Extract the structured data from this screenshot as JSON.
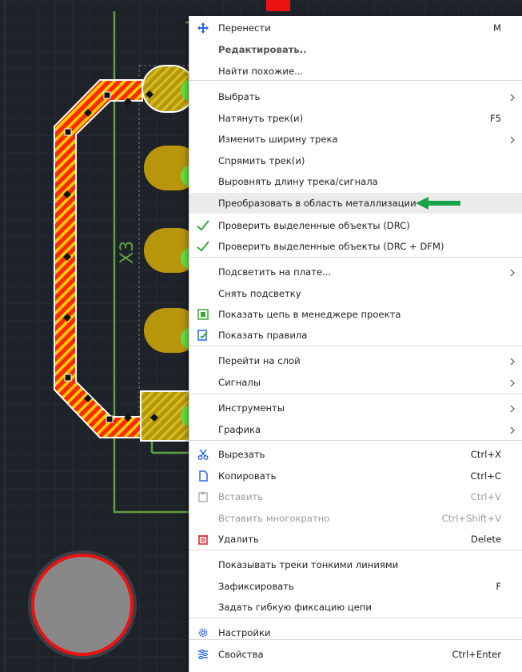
{
  "pcb": {
    "designator": "X3",
    "colors": {
      "bg": "#1e2229",
      "grid": "#2e333b",
      "silk": "#5fa142",
      "pad": "#b8960c",
      "pad_dot": "#66dd44",
      "track": "#ff2200",
      "stripe": "#ffcc00",
      "button_fill": "#888888",
      "button_ring": "#ee1111"
    }
  },
  "menu": {
    "items": [
      {
        "label": "Перенести",
        "shortcut": "M",
        "icon": "move-icon"
      },
      {
        "label": "Редактировать..",
        "style": "bold"
      },
      {
        "label": "Найти похожие..."
      },
      {
        "label": "Выбрать",
        "submenu": true
      },
      {
        "label": "Натянуть трек(и)",
        "shortcut": "F5"
      },
      {
        "label": "Изменить ширину трека",
        "submenu": true
      },
      {
        "label": "Спрямить трек(и)"
      },
      {
        "label": "Выровнять длину трека/сигнала"
      },
      {
        "label": "Преобразовать в область металлизации",
        "highlighted": true,
        "annotation": "green-arrow"
      },
      {
        "label": "Проверить выделенные объекты (DRC)",
        "icon": "checkmark-icon"
      },
      {
        "label": "Проверить выделенные объекты (DRC + DFM)",
        "icon": "checkmark-icon"
      },
      {
        "label": "Подсветить на плате...",
        "submenu": true
      },
      {
        "label": "Снять подсветку"
      },
      {
        "label": "Показать цепь в менеджере проекта",
        "icon": "project-manager-icon"
      },
      {
        "label": "Показать правила",
        "icon": "rules-icon"
      },
      {
        "label": "Перейти на слой",
        "submenu": true
      },
      {
        "label": "Сигналы",
        "submenu": true
      },
      {
        "label": "Инструменты",
        "submenu": true
      },
      {
        "label": "Графика",
        "submenu": true
      },
      {
        "label": "Вырезать",
        "shortcut": "Ctrl+X",
        "icon": "scissors-icon"
      },
      {
        "label": "Копировать",
        "shortcut": "Ctrl+C",
        "icon": "copy-icon"
      },
      {
        "label": "Вставить",
        "shortcut": "Ctrl+V",
        "icon": "paste-icon",
        "disabled": true
      },
      {
        "label": "Вставить многократно",
        "shortcut": "Ctrl+Shift+V",
        "disabled": true
      },
      {
        "label": "Удалить",
        "shortcut": "Delete",
        "icon": "trash-icon"
      },
      {
        "label": "Показывать треки тонкими линиями"
      },
      {
        "label": "Зафиксировать",
        "shortcut": "F"
      },
      {
        "label": "Задать гибкую фиксацию цепи"
      },
      {
        "label": "Настройки",
        "icon": "gear-icon"
      },
      {
        "label": "Свойства",
        "shortcut": "Ctrl+Enter",
        "icon": "properties-icon"
      }
    ],
    "colors": {
      "highlight": "#ebebeb",
      "check": "#3aa832",
      "arrow": "#16a34a",
      "trash": "#dd2222",
      "icon_blue": "#2563eb"
    }
  }
}
